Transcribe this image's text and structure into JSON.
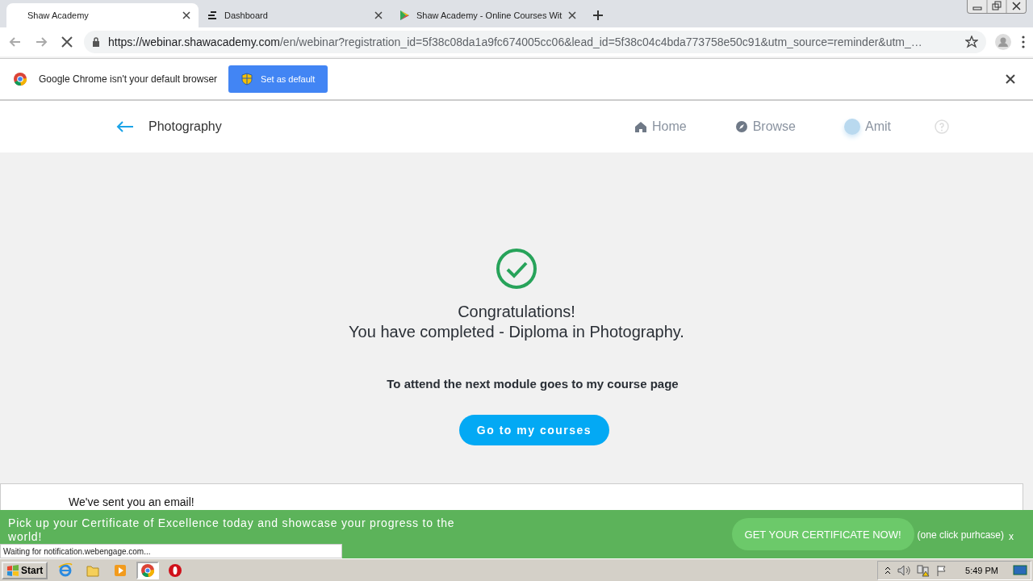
{
  "browser": {
    "tabs": [
      {
        "title": "Shaw Academy",
        "selected": true
      },
      {
        "title": "Dashboard",
        "selected": false
      },
      {
        "title": "Shaw Academy - Online Courses Wit",
        "selected": false
      }
    ],
    "url_host": "https://webinar.shawacademy.com",
    "url_path": "/en/webinar?registration_id=5f38c08da1a9fc674005cc06&lead_id=5f38c04c4bda773758e50c91&utm_source=reminder&utm_…",
    "infobar": {
      "message": "Google Chrome isn't your default browser",
      "button": "Set as default"
    },
    "status": "Waiting for notification.webengage.com..."
  },
  "site": {
    "back_label": "Photography",
    "nav": [
      {
        "label": "Home"
      },
      {
        "label": "Browse"
      },
      {
        "label": "Amit"
      }
    ]
  },
  "main": {
    "title": "Congratulations!",
    "subtitle": "You have completed - Diploma in Photography.",
    "note": "To attend the next module goes to my course page",
    "button": "Go to my courses",
    "email_note": "We've sent you an email!"
  },
  "banner": {
    "text": "Pick up your Certificate of Excellence today and showcase your progress to the world!",
    "button": "GET YOUR CERTIFICATE NOW!",
    "aside": "(one click purhcase)",
    "close": "x"
  },
  "taskbar": {
    "start": "Start",
    "apps": [
      {
        "selected": false
      },
      {
        "selected": false
      },
      {
        "selected": false
      },
      {
        "selected": true
      },
      {
        "selected": false
      }
    ],
    "clock": "5:49 PM"
  }
}
